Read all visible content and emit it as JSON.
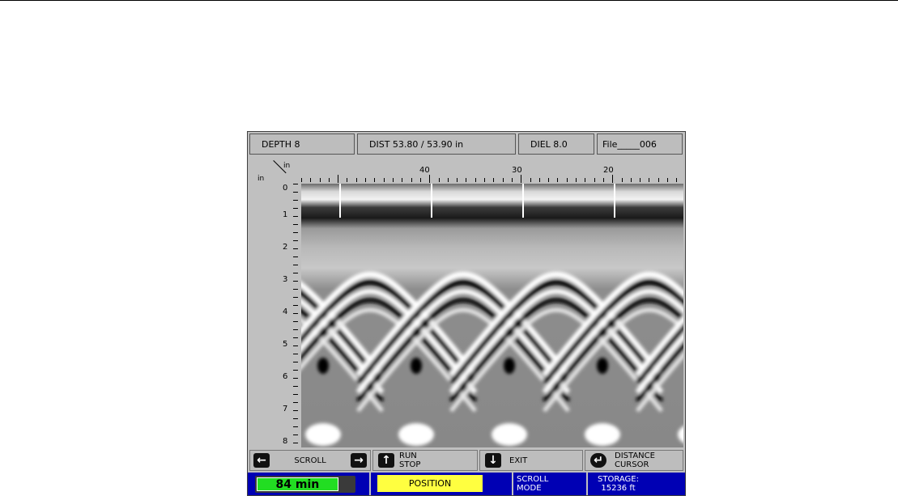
{
  "header": {
    "depth": "DEPTH  8",
    "dist": "DIST 53.80 / 53.90 in",
    "diel": "DIEL 8.0",
    "file": "File_____006"
  },
  "axes": {
    "x_unit": "in",
    "y_unit": "in",
    "x_ticks": [
      "40",
      "30",
      "20"
    ],
    "y_ticks": [
      "0",
      "1",
      "2",
      "3",
      "4",
      "5",
      "6",
      "7",
      "8"
    ]
  },
  "buttons": {
    "scroll_label": "SCROLL",
    "run_line1": "RUN",
    "run_line2": "STOP",
    "exit_label": "EXIT",
    "distance_line1": "DISTANCE",
    "distance_line2": "CURSOR"
  },
  "icons": {
    "left": "arrow-left-icon",
    "right": "arrow-right-icon",
    "up": "arrow-up-icon",
    "down": "arrow-down-icon",
    "enter": "enter-icon"
  },
  "status": {
    "battery": "84 min",
    "battery_level_percent": 84,
    "position": "POSITION",
    "scroll_line1": "SCROLL",
    "scroll_line2": "MODE",
    "storage_line1": "STORAGE:",
    "storage_line2": "15236 ft"
  },
  "colors": {
    "status_bar": "#0000b4",
    "position_highlight": "#ffff40",
    "battery_fill": "#22dd22"
  }
}
